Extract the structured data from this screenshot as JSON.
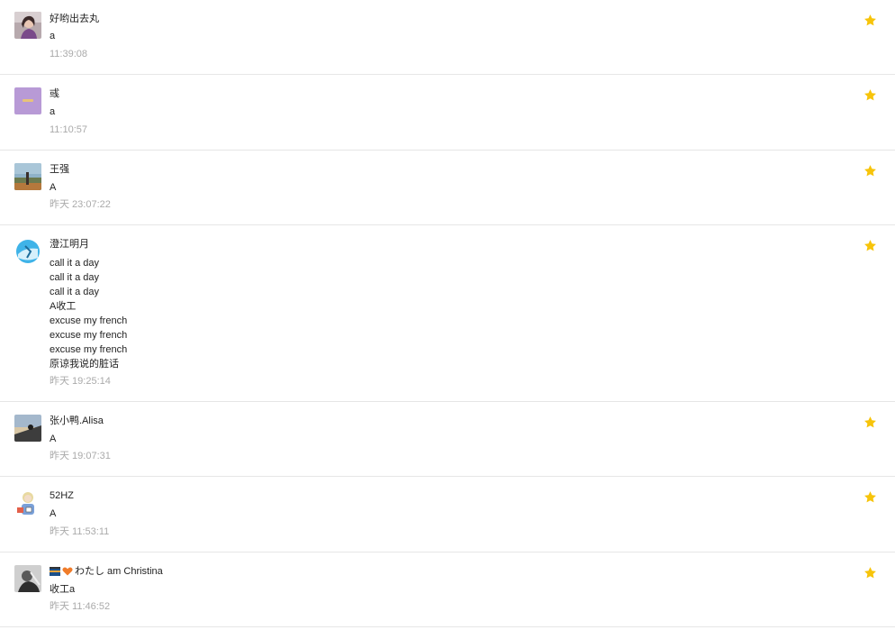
{
  "colors": {
    "star": "#f7c40a",
    "divider": "#e6e6e6",
    "time": "#aaaaaa",
    "text": "#222222"
  },
  "messages": [
    {
      "name": "好哟出去丸",
      "lines": [
        "a"
      ],
      "time": "11:39:08",
      "starred": true,
      "avatar_icon": "girl-portrait-avatar"
    },
    {
      "name": "彧",
      "lines": [
        "a"
      ],
      "time": "11:10:57",
      "starred": true,
      "avatar_icon": "purple-square-avatar"
    },
    {
      "name": "王强",
      "lines": [
        "A"
      ],
      "time": "昨天 23:07:22",
      "starred": true,
      "avatar_icon": "landscape-avatar"
    },
    {
      "name": "澄江明月",
      "lines": [
        "call it a day",
        "call it a day",
        "call it a day",
        "A收工",
        "excuse my french",
        "excuse my french",
        "excuse my french",
        "原谅我说的脏话"
      ],
      "time": "昨天 19:25:14",
      "starred": true,
      "avatar_icon": "blue-circle-avatar"
    },
    {
      "name": "张小鸭.Alisa",
      "lines": [
        "A"
      ],
      "time": "昨天 19:07:31",
      "starred": true,
      "avatar_icon": "beach-photo-avatar"
    },
    {
      "name": "52HZ",
      "lines": [
        "A"
      ],
      "time": "昨天 11:53:11",
      "starred": true,
      "avatar_icon": "cartoon-avatar"
    },
    {
      "name": "わたし am Christina",
      "lines": [
        "收工a"
      ],
      "time": "昨天 11:46:52",
      "starred": true,
      "avatar_icon": "gray-portrait-avatar"
    }
  ]
}
